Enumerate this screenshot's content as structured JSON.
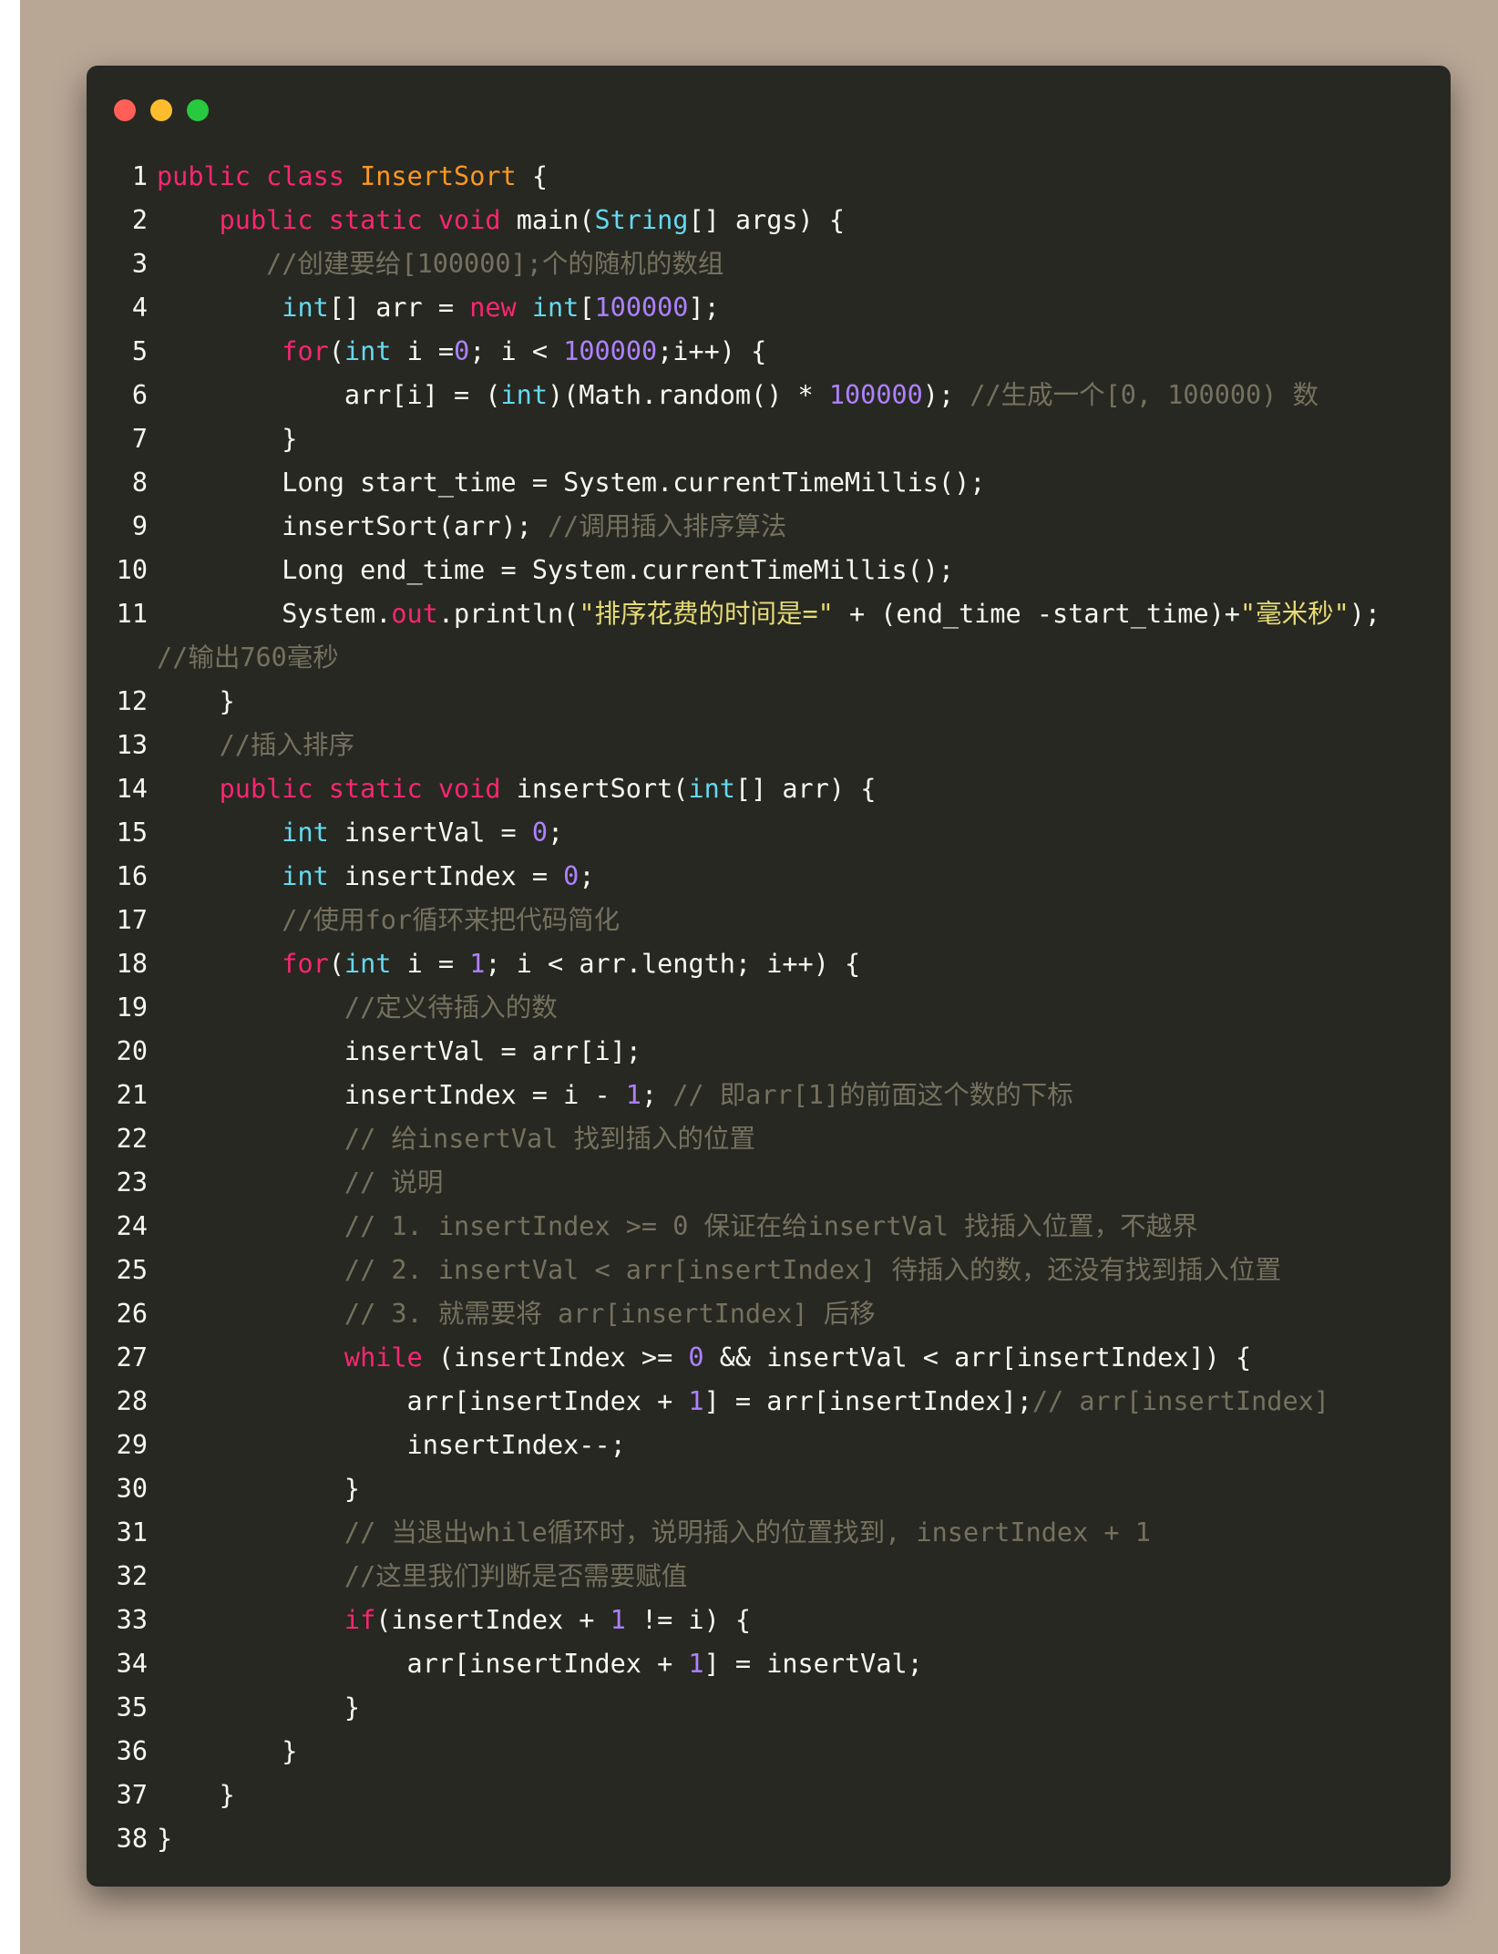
{
  "colors": {
    "background": "#b9a796",
    "editor": "#272822",
    "plain": "#f8f8f2",
    "keyword": "#f92672",
    "type": "#66d9ef",
    "class_name": "#fd971f",
    "number": "#ae81ff",
    "string": "#e6db74",
    "comment": "#75715e"
  },
  "window_controls": [
    "close",
    "minimize",
    "maximize"
  ],
  "lines": [
    {
      "n": "1",
      "tokens": [
        [
          "kw",
          "public"
        ],
        [
          "pl",
          " "
        ],
        [
          "kw",
          "class"
        ],
        [
          "pl",
          " "
        ],
        [
          "cls",
          "InsertSort"
        ],
        [
          "pl",
          " {"
        ]
      ]
    },
    {
      "n": "2",
      "tokens": [
        [
          "pl",
          "    "
        ],
        [
          "kw",
          "public"
        ],
        [
          "pl",
          " "
        ],
        [
          "kw",
          "static"
        ],
        [
          "pl",
          " "
        ],
        [
          "kw",
          "void"
        ],
        [
          "pl",
          " main("
        ],
        [
          "ty",
          "String"
        ],
        [
          "pl",
          "[] args) {"
        ]
      ]
    },
    {
      "n": "3",
      "tokens": [
        [
          "pl",
          "       "
        ],
        [
          "cmt",
          "//创建要给[100000];个的随机的数组"
        ]
      ]
    },
    {
      "n": "4",
      "tokens": [
        [
          "pl",
          "        "
        ],
        [
          "ty",
          "int"
        ],
        [
          "pl",
          "[] arr = "
        ],
        [
          "kw",
          "new"
        ],
        [
          "pl",
          " "
        ],
        [
          "ty",
          "int"
        ],
        [
          "pl",
          "["
        ],
        [
          "num",
          "100000"
        ],
        [
          "pl",
          "];"
        ]
      ]
    },
    {
      "n": "5",
      "tokens": [
        [
          "pl",
          "        "
        ],
        [
          "kw",
          "for"
        ],
        [
          "pl",
          "("
        ],
        [
          "ty",
          "int"
        ],
        [
          "pl",
          " i ="
        ],
        [
          "num",
          "0"
        ],
        [
          "pl",
          "; i < "
        ],
        [
          "num",
          "100000"
        ],
        [
          "pl",
          ";i++) {"
        ]
      ]
    },
    {
      "n": "6",
      "tokens": [
        [
          "pl",
          "            arr[i] = ("
        ],
        [
          "ty",
          "int"
        ],
        [
          "pl",
          ")(Math.random() * "
        ],
        [
          "num",
          "100000"
        ],
        [
          "pl",
          "); "
        ],
        [
          "cmt",
          "//生成一个[0, 100000) 数"
        ]
      ]
    },
    {
      "n": "7",
      "tokens": [
        [
          "pl",
          "        }"
        ]
      ]
    },
    {
      "n": "8",
      "tokens": [
        [
          "pl",
          "        Long start_time = System.currentTimeMillis();"
        ]
      ]
    },
    {
      "n": "9",
      "tokens": [
        [
          "pl",
          "        insertSort(arr); "
        ],
        [
          "cmt",
          "//调用插入排序算法"
        ]
      ]
    },
    {
      "n": "10",
      "tokens": [
        [
          "pl",
          "        Long end_time = System.currentTimeMillis();"
        ]
      ]
    },
    {
      "n": "11",
      "tokens": [
        [
          "pl",
          "        System."
        ],
        [
          "kw",
          "out"
        ],
        [
          "pl",
          ".println("
        ],
        [
          "str",
          "\"排序花费的时间是=\""
        ],
        [
          "pl",
          " + (end_time -start_time)+"
        ],
        [
          "str",
          "\"毫米秒\""
        ],
        [
          "pl",
          "); "
        ],
        [
          "cmt",
          "//输出760毫秒"
        ]
      ]
    },
    {
      "n": "12",
      "tokens": [
        [
          "pl",
          "    }"
        ]
      ]
    },
    {
      "n": "13",
      "tokens": [
        [
          "pl",
          "    "
        ],
        [
          "cmt",
          "//插入排序"
        ]
      ]
    },
    {
      "n": "14",
      "tokens": [
        [
          "pl",
          "    "
        ],
        [
          "kw",
          "public"
        ],
        [
          "pl",
          " "
        ],
        [
          "kw",
          "static"
        ],
        [
          "pl",
          " "
        ],
        [
          "kw",
          "void"
        ],
        [
          "pl",
          " insertSort("
        ],
        [
          "ty",
          "int"
        ],
        [
          "pl",
          "[] arr) {"
        ]
      ]
    },
    {
      "n": "15",
      "tokens": [
        [
          "pl",
          "        "
        ],
        [
          "ty",
          "int"
        ],
        [
          "pl",
          " insertVal = "
        ],
        [
          "num",
          "0"
        ],
        [
          "pl",
          ";"
        ]
      ]
    },
    {
      "n": "16",
      "tokens": [
        [
          "pl",
          "        "
        ],
        [
          "ty",
          "int"
        ],
        [
          "pl",
          " insertIndex = "
        ],
        [
          "num",
          "0"
        ],
        [
          "pl",
          ";"
        ]
      ]
    },
    {
      "n": "17",
      "tokens": [
        [
          "pl",
          "        "
        ],
        [
          "cmt",
          "//使用for循环来把代码简化"
        ]
      ]
    },
    {
      "n": "18",
      "tokens": [
        [
          "pl",
          "        "
        ],
        [
          "kw",
          "for"
        ],
        [
          "pl",
          "("
        ],
        [
          "ty",
          "int"
        ],
        [
          "pl",
          " i = "
        ],
        [
          "num",
          "1"
        ],
        [
          "pl",
          "; i < arr.length; i++) {"
        ]
      ]
    },
    {
      "n": "19",
      "tokens": [
        [
          "pl",
          "            "
        ],
        [
          "cmt",
          "//定义待插入的数"
        ]
      ]
    },
    {
      "n": "20",
      "tokens": [
        [
          "pl",
          "            insertVal = arr[i];"
        ]
      ]
    },
    {
      "n": "21",
      "tokens": [
        [
          "pl",
          "            insertIndex = i - "
        ],
        [
          "num",
          "1"
        ],
        [
          "pl",
          "; "
        ],
        [
          "cmt",
          "// 即arr[1]的前面这个数的下标"
        ]
      ]
    },
    {
      "n": "22",
      "tokens": [
        [
          "pl",
          "            "
        ],
        [
          "cmt",
          "// 给insertVal 找到插入的位置"
        ]
      ]
    },
    {
      "n": "23",
      "tokens": [
        [
          "pl",
          "            "
        ],
        [
          "cmt",
          "// 说明"
        ]
      ]
    },
    {
      "n": "24",
      "tokens": [
        [
          "pl",
          "            "
        ],
        [
          "cmt",
          "// 1. insertIndex >= 0 保证在给insertVal 找插入位置，不越界"
        ]
      ]
    },
    {
      "n": "25",
      "tokens": [
        [
          "pl",
          "            "
        ],
        [
          "cmt",
          "// 2. insertVal < arr[insertIndex] 待插入的数，还没有找到插入位置"
        ]
      ]
    },
    {
      "n": "26",
      "tokens": [
        [
          "pl",
          "            "
        ],
        [
          "cmt",
          "// 3. 就需要将 arr[insertIndex] 后移"
        ]
      ]
    },
    {
      "n": "27",
      "tokens": [
        [
          "pl",
          "            "
        ],
        [
          "kw",
          "while"
        ],
        [
          "pl",
          " (insertIndex >= "
        ],
        [
          "num",
          "0"
        ],
        [
          "pl",
          " && insertVal < arr[insertIndex]) {"
        ]
      ]
    },
    {
      "n": "28",
      "tokens": [
        [
          "pl",
          "                arr[insertIndex + "
        ],
        [
          "num",
          "1"
        ],
        [
          "pl",
          "] = arr[insertIndex];"
        ],
        [
          "cmt",
          "// arr[insertIndex]"
        ]
      ]
    },
    {
      "n": "29",
      "tokens": [
        [
          "pl",
          "                insertIndex--;"
        ]
      ]
    },
    {
      "n": "30",
      "tokens": [
        [
          "pl",
          "            }"
        ]
      ]
    },
    {
      "n": "31",
      "tokens": [
        [
          "pl",
          "            "
        ],
        [
          "cmt",
          "// 当退出while循环时，说明插入的位置找到, insertIndex + 1"
        ]
      ]
    },
    {
      "n": "32",
      "tokens": [
        [
          "pl",
          "            "
        ],
        [
          "cmt",
          "//这里我们判断是否需要赋值"
        ]
      ]
    },
    {
      "n": "33",
      "tokens": [
        [
          "pl",
          "            "
        ],
        [
          "kw",
          "if"
        ],
        [
          "pl",
          "(insertIndex + "
        ],
        [
          "num",
          "1"
        ],
        [
          "pl",
          " != i) {"
        ]
      ]
    },
    {
      "n": "34",
      "tokens": [
        [
          "pl",
          "                arr[insertIndex + "
        ],
        [
          "num",
          "1"
        ],
        [
          "pl",
          "] = insertVal;"
        ]
      ]
    },
    {
      "n": "35",
      "tokens": [
        [
          "pl",
          "            }"
        ]
      ]
    },
    {
      "n": "36",
      "tokens": [
        [
          "pl",
          "        }"
        ]
      ]
    },
    {
      "n": "37",
      "tokens": [
        [
          "pl",
          "    }"
        ]
      ]
    },
    {
      "n": "38",
      "tokens": [
        [
          "pl",
          "}"
        ]
      ]
    }
  ]
}
